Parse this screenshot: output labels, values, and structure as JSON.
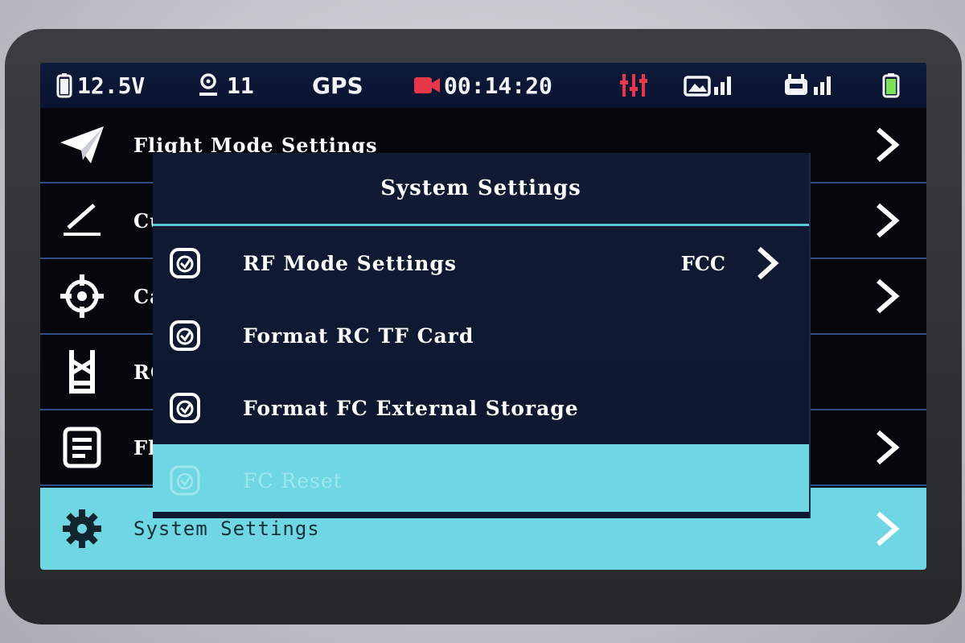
{
  "status_bar": {
    "battery_voltage": "12.5V",
    "satellite_count": "11",
    "gps_label": "GPS",
    "recording_time": "00:14:20"
  },
  "menu": {
    "items": [
      {
        "label": "Flight Mode Settings",
        "icon": "paper-plane-icon"
      },
      {
        "label": "Cu",
        "icon": "pen-icon"
      },
      {
        "label": "Ca",
        "icon": "crosshair-icon"
      },
      {
        "label": "RC",
        "icon": "rc-icon"
      },
      {
        "label": "Fl",
        "icon": "document-icon"
      },
      {
        "label": "System Settings",
        "icon": "gear-icon"
      }
    ]
  },
  "dialog": {
    "title": "System Settings",
    "items": [
      {
        "label": "RF Mode Settings",
        "value": "FCC"
      },
      {
        "label": "Format RC TF Card"
      },
      {
        "label": "Format FC External Storage"
      },
      {
        "label": "FC Reset"
      }
    ]
  },
  "colors": {
    "accent": "#6fd7e3",
    "status_bar_bg": "#0e1a3a",
    "recording_red": "#e8364b",
    "battery_green": "#7be25a"
  }
}
